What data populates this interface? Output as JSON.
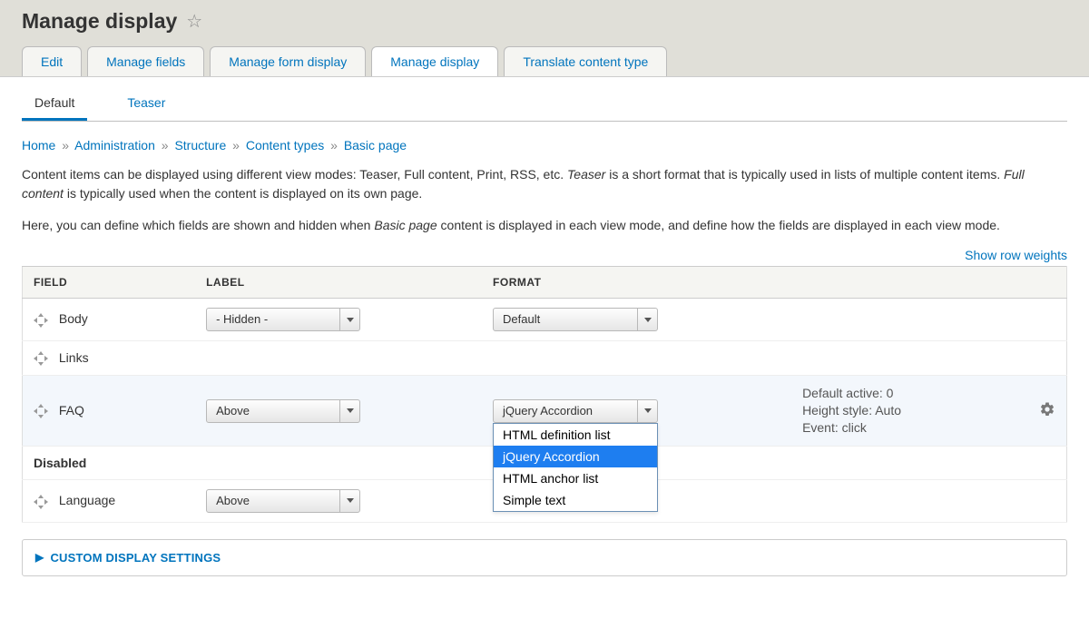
{
  "header": {
    "title": "Manage display"
  },
  "primary_tabs": [
    {
      "label": "Edit",
      "active": false
    },
    {
      "label": "Manage fields",
      "active": false
    },
    {
      "label": "Manage form display",
      "active": false
    },
    {
      "label": "Manage display",
      "active": true
    },
    {
      "label": "Translate content type",
      "active": false
    }
  ],
  "secondary_tabs": [
    {
      "label": "Default",
      "active": true
    },
    {
      "label": "Teaser",
      "active": false
    }
  ],
  "breadcrumb": [
    "Home",
    "Administration",
    "Structure",
    "Content types",
    "Basic page"
  ],
  "help": {
    "p1a": "Content items can be displayed using different view modes: Teaser, Full content, Print, RSS, etc. ",
    "p1b": "Teaser",
    "p1c": " is a short format that is typically used in lists of multiple content items. ",
    "p1d": "Full content",
    "p1e": " is typically used when the content is displayed on its own page.",
    "p2a": "Here, you can define which fields are shown and hidden when ",
    "p2b": "Basic page",
    "p2c": " content is displayed in each view mode, and define how the fields are displayed in each view mode."
  },
  "show_row_weights": "Show row weights",
  "table": {
    "headers": {
      "field": "FIELD",
      "label": "LABEL",
      "format": "FORMAT"
    },
    "rows": [
      {
        "kind": "field",
        "name": "Body",
        "label_select": "- Hidden -",
        "format_select": "Default"
      },
      {
        "kind": "field",
        "name": "Links"
      },
      {
        "kind": "field",
        "name": "FAQ",
        "label_select": "Above",
        "format_select": "jQuery Accordion",
        "format_options_open": true,
        "format_options": [
          "HTML definition list",
          "jQuery Accordion",
          "HTML anchor list",
          "Simple text"
        ],
        "summary": {
          "l1": "Default active: 0",
          "l2": "Height style: Auto",
          "l3": "Event: click"
        },
        "has_gear": true
      },
      {
        "kind": "section",
        "name": "Disabled"
      },
      {
        "kind": "field",
        "name": "Language",
        "label_select": "Above"
      }
    ]
  },
  "details": {
    "title": "CUSTOM DISPLAY SETTINGS"
  }
}
